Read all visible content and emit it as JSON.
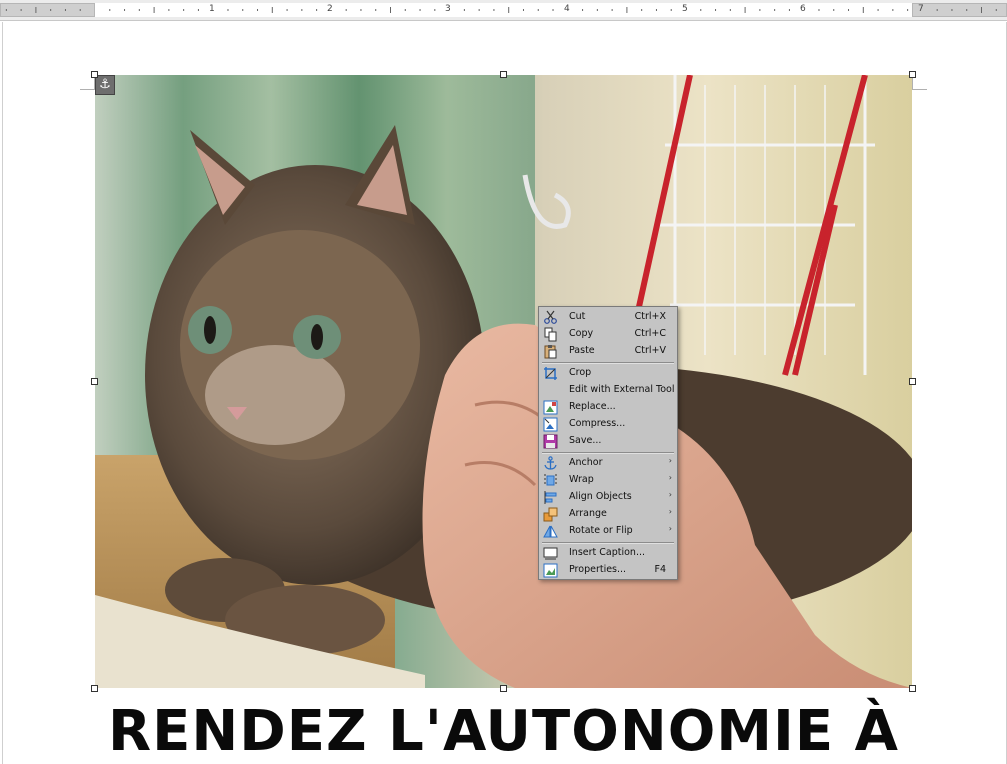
{
  "ruler": {
    "numbers": [
      "1",
      "2",
      "3",
      "4",
      "5",
      "6",
      "7"
    ]
  },
  "document": {
    "heading": "RENDEZ L'AUTONOMIE À"
  },
  "context_menu": {
    "items": [
      {
        "label": "Cut",
        "shortcut": "Ctrl+X",
        "icon": "scissors-icon"
      },
      {
        "label": "Copy",
        "shortcut": "Ctrl+C",
        "icon": "copy-icon"
      },
      {
        "label": "Paste",
        "shortcut": "Ctrl+V",
        "icon": "paste-icon"
      },
      {
        "label": "Crop",
        "shortcut": "",
        "icon": "crop-icon"
      },
      {
        "label": "Edit with External Tool",
        "shortcut": "",
        "icon": ""
      },
      {
        "label": "Replace...",
        "shortcut": "",
        "icon": "replace-image-icon"
      },
      {
        "label": "Compress...",
        "shortcut": "",
        "icon": "compress-image-icon"
      },
      {
        "label": "Save...",
        "shortcut": "",
        "icon": "save-icon"
      },
      {
        "label": "Anchor",
        "shortcut": "",
        "icon": "anchor-icon",
        "submenu": true
      },
      {
        "label": "Wrap",
        "shortcut": "",
        "icon": "wrap-icon",
        "submenu": true
      },
      {
        "label": "Align Objects",
        "shortcut": "",
        "icon": "align-icon",
        "submenu": true
      },
      {
        "label": "Arrange",
        "shortcut": "",
        "icon": "arrange-icon",
        "submenu": true
      },
      {
        "label": "Rotate or Flip",
        "shortcut": "",
        "icon": "rotate-icon",
        "submenu": true
      },
      {
        "label": "Insert Caption...",
        "shortcut": "",
        "icon": "caption-icon"
      },
      {
        "label": "Properties...",
        "shortcut": "F4",
        "icon": "properties-icon"
      }
    ],
    "submenu_arrow": "›"
  },
  "colors": {
    "menu_bg": "#c4c4c4",
    "heading": "#0a0a0a"
  }
}
